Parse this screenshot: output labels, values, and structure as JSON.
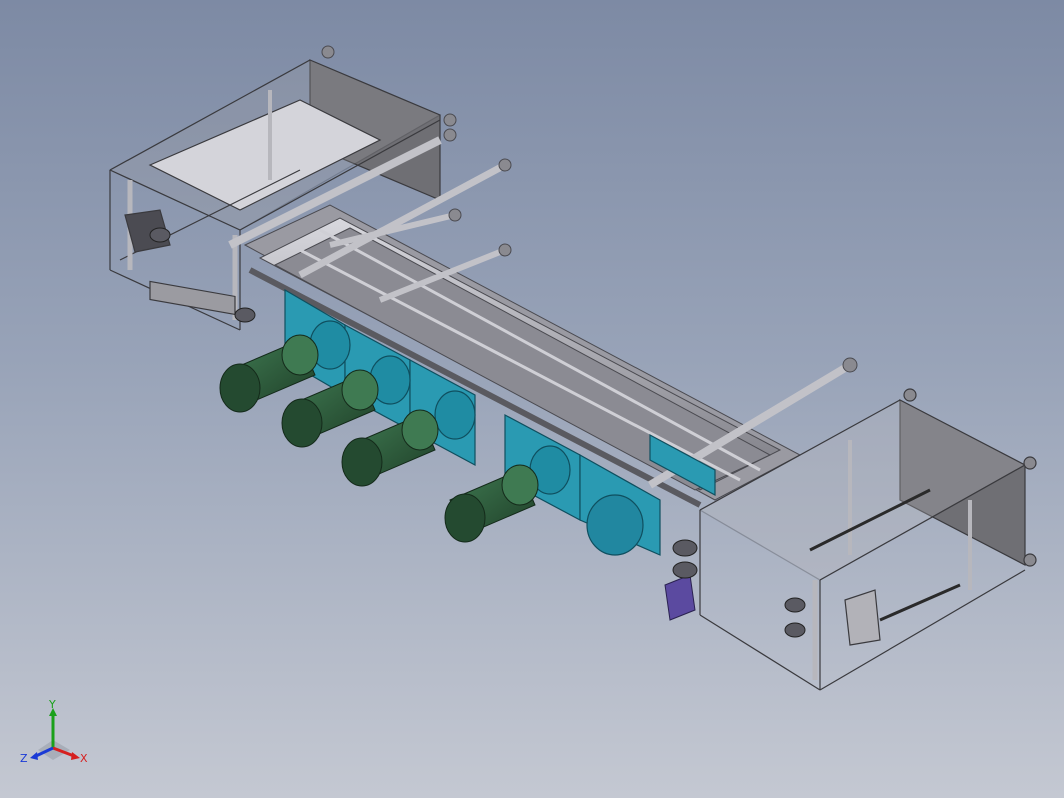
{
  "viewport": {
    "background_top": "#7d8aa4",
    "background_bottom": "#c4c8d2"
  },
  "model": {
    "frame_color": "#6e6e72",
    "frame_light": "#b7b7bd",
    "panel_color": "#c9c9cf",
    "carriage_color": "#2a9ab2",
    "motor_color": "#2d5a3a",
    "stepper_color": "#5b4aa0"
  },
  "triad": {
    "x_label": "X",
    "y_label": "Y",
    "z_label": "Z",
    "x_color": "#d62020",
    "y_color": "#1aa01a",
    "z_color": "#1a3ad6"
  }
}
